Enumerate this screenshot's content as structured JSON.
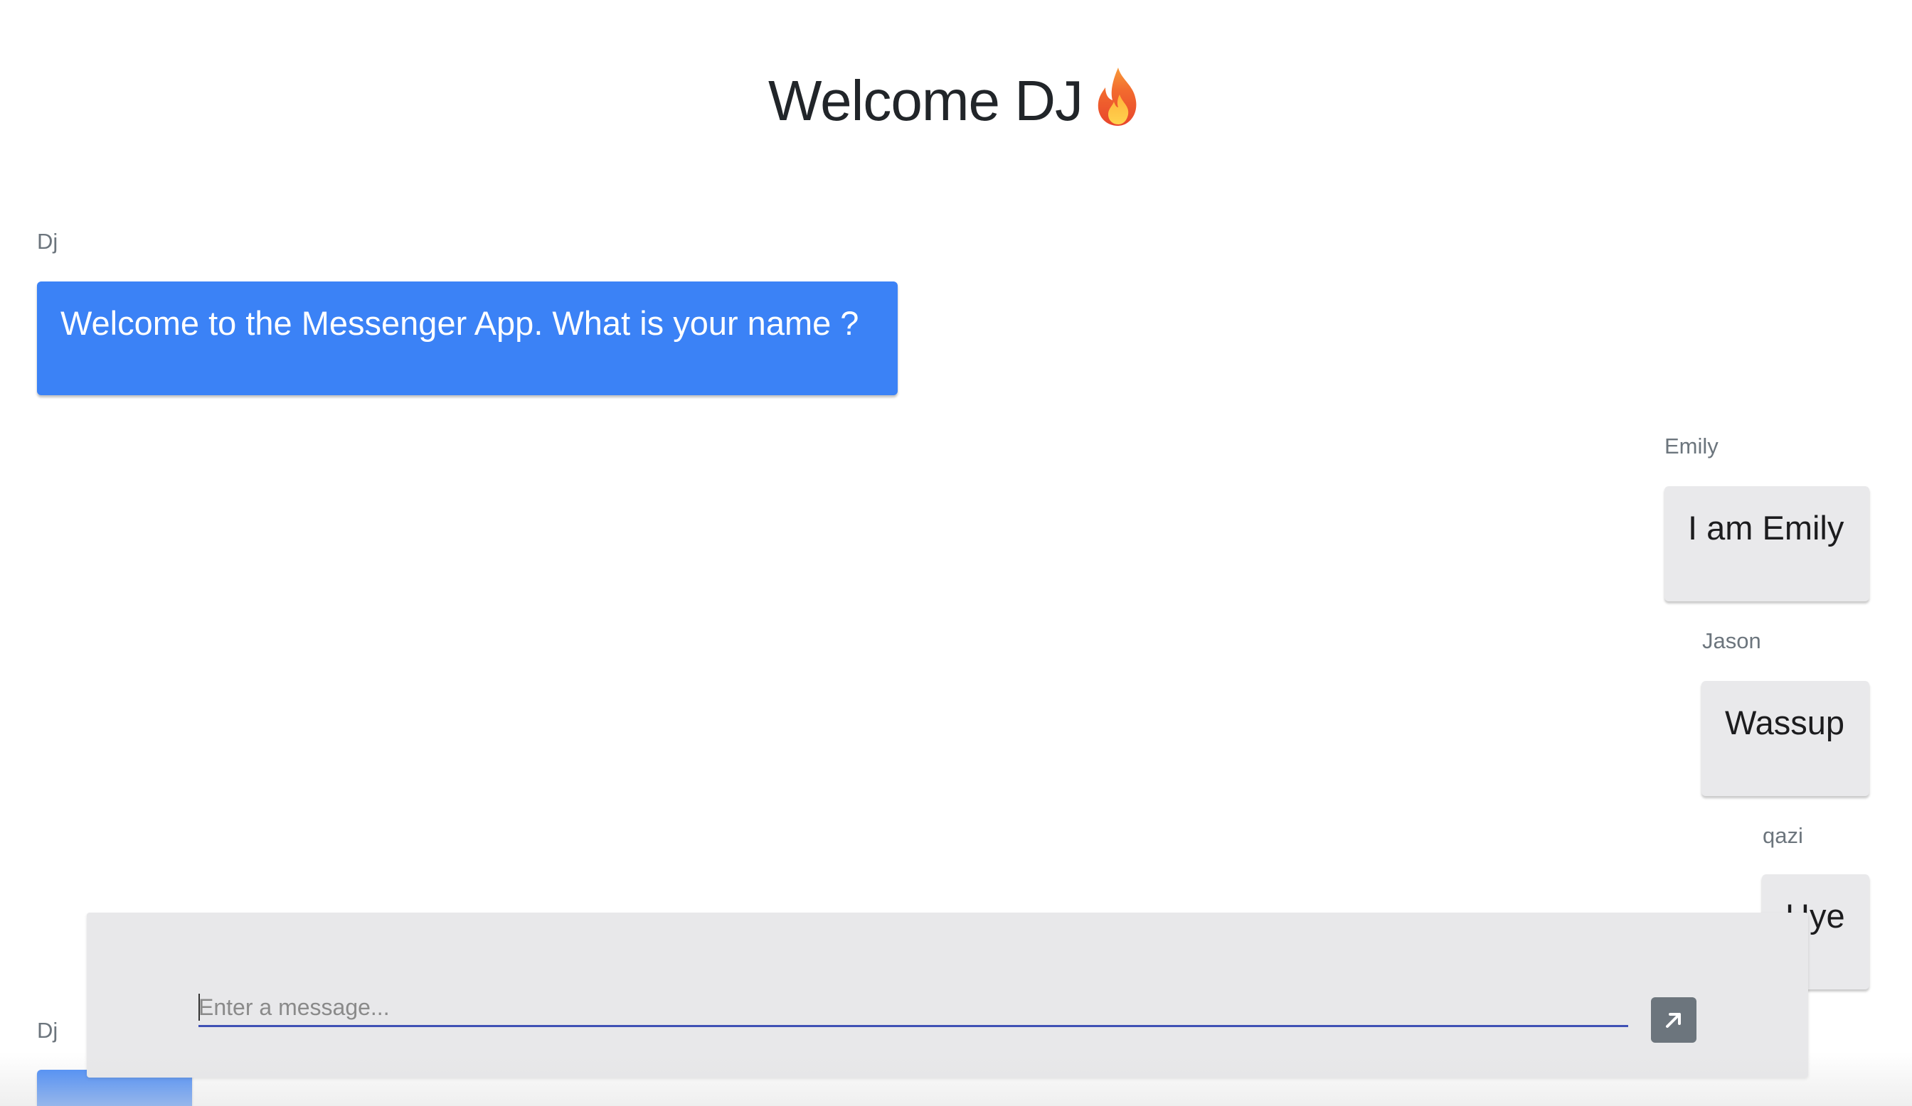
{
  "header": {
    "title": "Welcome DJ",
    "emoji_icon": "fire-emoji"
  },
  "messages": [
    {
      "sender": "Dj",
      "text": "Welcome to the Messenger App. What is your name ?",
      "own": true
    },
    {
      "sender": "Emily",
      "text": "I am Emily",
      "own": false
    },
    {
      "sender": "Jason",
      "text": "Wassup",
      "own": false
    },
    {
      "sender": "qazi",
      "text": "Hye",
      "own": false
    },
    {
      "sender": "Dj",
      "text": "",
      "own": true
    }
  ],
  "composer": {
    "placeholder": "Enter a message...",
    "value": "",
    "send_icon": "arrow-up-right-icon"
  },
  "colors": {
    "own_bubble": "#3b82f6",
    "other_bubble": "#e9e9eb",
    "composer_bg": "#e8e8ea",
    "input_underline": "#3f51b5",
    "send_button": "#6c757d"
  }
}
